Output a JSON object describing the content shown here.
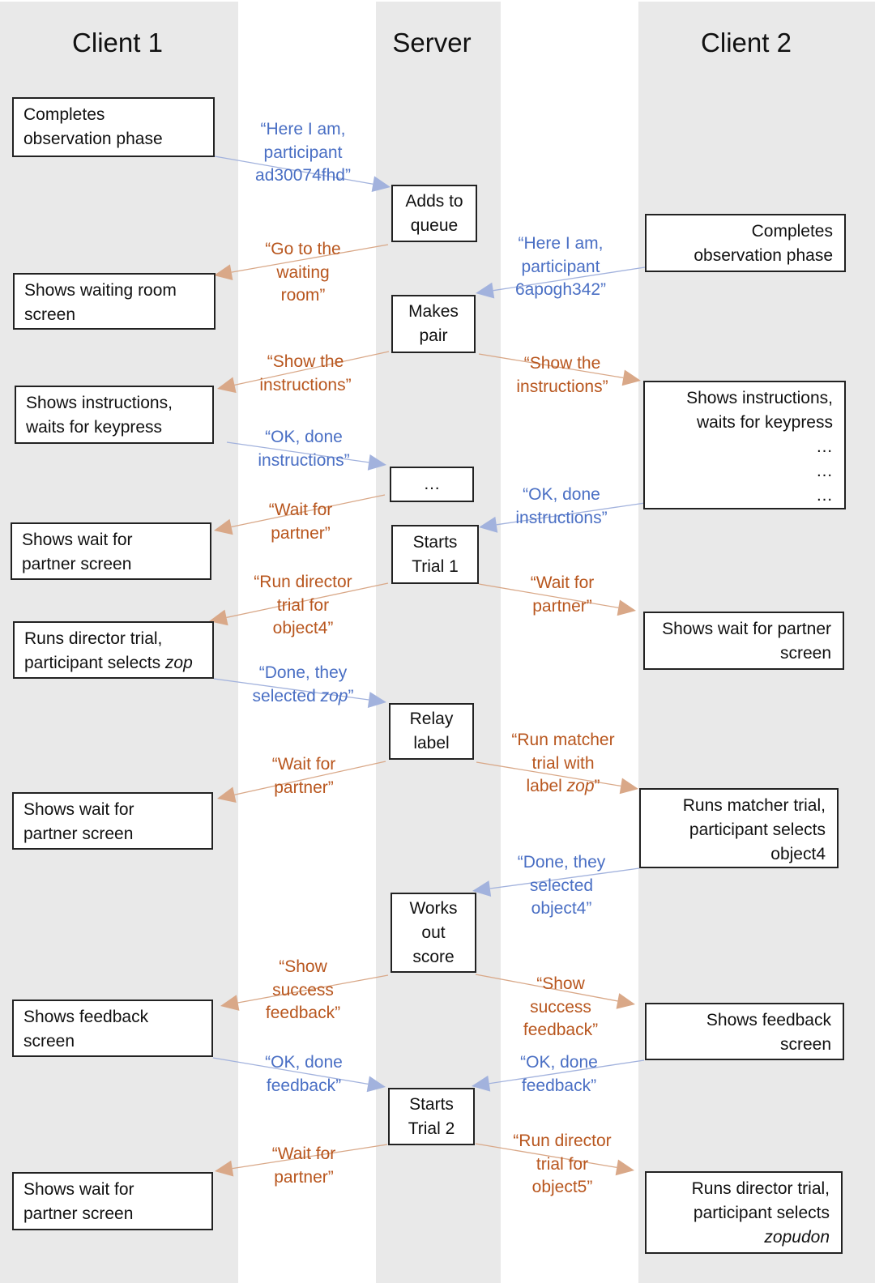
{
  "colors": {
    "lane_bg": "#e9e9e9",
    "client_to_server": "#4a6fc4",
    "client_to_server_line": "#a2b2dd",
    "server_to_client": "#b8561e",
    "server_to_client_line": "#d9a888"
  },
  "lanes": {
    "client1": "Client 1",
    "server": "Server",
    "client2": "Client 2"
  },
  "client1": {
    "boxes": [
      {
        "lines": [
          "Completes",
          "observation phase"
        ]
      },
      {
        "lines": [
          "Shows waiting room",
          "screen"
        ]
      },
      {
        "lines": [
          "Shows instructions,",
          "waits for keypress"
        ]
      },
      {
        "lines": [
          "Shows wait for",
          "partner screen"
        ]
      },
      {
        "lines": [
          "Runs director trial,",
          "participant selects "
        ],
        "italic_suffix": "zop"
      },
      {
        "lines": [
          "Shows wait for",
          "partner screen"
        ]
      },
      {
        "lines": [
          "Shows feedback",
          "screen"
        ]
      },
      {
        "lines": [
          "Shows wait for",
          "partner screen"
        ]
      }
    ]
  },
  "server": {
    "boxes": [
      {
        "lines": [
          "Adds to",
          "queue"
        ]
      },
      {
        "lines": [
          "Makes",
          "pair"
        ]
      },
      {
        "lines": [
          "…"
        ]
      },
      {
        "lines": [
          "Starts",
          "Trial 1"
        ]
      },
      {
        "lines": [
          "Relay",
          "label"
        ]
      },
      {
        "lines": [
          "Works",
          "out",
          "score"
        ]
      },
      {
        "lines": [
          "Starts",
          "Trial 2"
        ]
      }
    ]
  },
  "client2": {
    "boxes": [
      {
        "lines": [
          "Completes",
          "observation phase"
        ]
      },
      {
        "lines": [
          "Shows instructions,",
          "waits for keypress",
          "…",
          "…",
          "…"
        ]
      },
      {
        "lines": [
          "Shows wait for partner",
          "screen"
        ]
      },
      {
        "lines": [
          "Runs matcher trial,",
          "participant selects",
          "object4"
        ]
      },
      {
        "lines": [
          "Shows feedback",
          "screen"
        ]
      },
      {
        "lines": [
          "Runs director trial,",
          "participant selects",
          ""
        ],
        "italic_last": "zopudon"
      }
    ]
  },
  "messages": [
    {
      "direction": "client1-to-server",
      "lines": [
        "“Here I am,",
        "participant",
        "ad30074fhd”"
      ]
    },
    {
      "direction": "server-to-client1",
      "lines": [
        "“Go to the",
        "waiting",
        "room”"
      ]
    },
    {
      "direction": "client2-to-server",
      "lines": [
        "“Here I am,",
        "participant",
        "6apogh342”"
      ]
    },
    {
      "direction": "server-to-client1",
      "lines": [
        "“Show the",
        "instructions”"
      ]
    },
    {
      "direction": "server-to-client2",
      "lines": [
        "“Show the",
        "instructions”"
      ]
    },
    {
      "direction": "client1-to-server",
      "lines": [
        "“OK, done",
        "instructions”"
      ]
    },
    {
      "direction": "server-to-client1",
      "lines": [
        "“Wait for",
        "partner”"
      ]
    },
    {
      "direction": "client2-to-server",
      "lines": [
        "“OK, done",
        "instructions”"
      ]
    },
    {
      "direction": "server-to-client1",
      "lines": [
        "“Run director",
        "trial for",
        "object4”"
      ]
    },
    {
      "direction": "server-to-client2",
      "lines": [
        "“Wait for",
        "partner”"
      ]
    },
    {
      "direction": "client1-to-server",
      "lines": [
        "“Done, they",
        "selected "
      ],
      "italic_suffix": "zop",
      "suffix_after": "”"
    },
    {
      "direction": "server-to-client1",
      "lines": [
        "“Wait for",
        "partner”"
      ]
    },
    {
      "direction": "server-to-client2",
      "lines": [
        "“Run matcher",
        "trial with",
        "label "
      ],
      "italic_suffix": "zop",
      "suffix_after": "”"
    },
    {
      "direction": "client2-to-server",
      "lines": [
        "“Done, they",
        "selected",
        "object4”"
      ]
    },
    {
      "direction": "server-to-client1",
      "lines": [
        "“Show",
        "success",
        "feedback”"
      ]
    },
    {
      "direction": "server-to-client2",
      "lines": [
        "“Show",
        "success",
        "feedback”"
      ]
    },
    {
      "direction": "client1-to-server",
      "lines": [
        "“OK, done",
        "feedback”"
      ]
    },
    {
      "direction": "client2-to-server",
      "lines": [
        "“OK, done",
        "feedback”"
      ]
    },
    {
      "direction": "server-to-client1",
      "lines": [
        "“Wait for",
        "partner”"
      ]
    },
    {
      "direction": "server-to-client2",
      "lines": [
        "“Run director",
        "trial for",
        "object5”"
      ]
    }
  ]
}
